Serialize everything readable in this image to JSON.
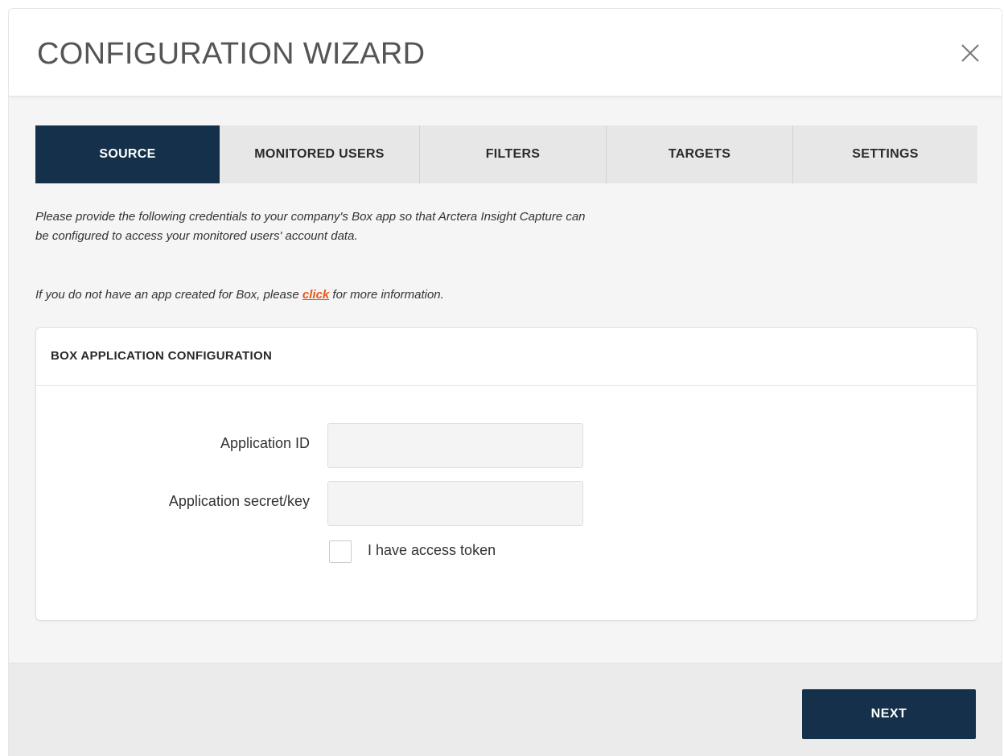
{
  "dialog": {
    "title": "CONFIGURATION WIZARD",
    "close_icon": "close-icon"
  },
  "tabs": [
    {
      "label": "SOURCE",
      "active": true
    },
    {
      "label": "MONITORED USERS",
      "active": false
    },
    {
      "label": "FILTERS",
      "active": false
    },
    {
      "label": "TARGETS",
      "active": false
    },
    {
      "label": "SETTINGS",
      "active": false
    }
  ],
  "intro": {
    "line1": "Please provide the following credentials to your company's Box app so that Arctera Insight Capture can",
    "line2": "be configured to access your monitored users' account data."
  },
  "info": {
    "prefix": "If you do not have an app created for Box, please ",
    "link": "click",
    "suffix": " for more information."
  },
  "panel": {
    "title": "BOX APPLICATION CONFIGURATION",
    "fields": {
      "app_id": {
        "label": "Application ID",
        "value": "",
        "placeholder": ""
      },
      "app_secret": {
        "label": "Application secret/key",
        "value": "",
        "placeholder": ""
      }
    },
    "access_token": {
      "label": "I have access token",
      "checked": false
    }
  },
  "footer": {
    "next_label": "NEXT"
  },
  "colors": {
    "primary_navy": "#15304a",
    "link_orange": "#e8561a"
  }
}
